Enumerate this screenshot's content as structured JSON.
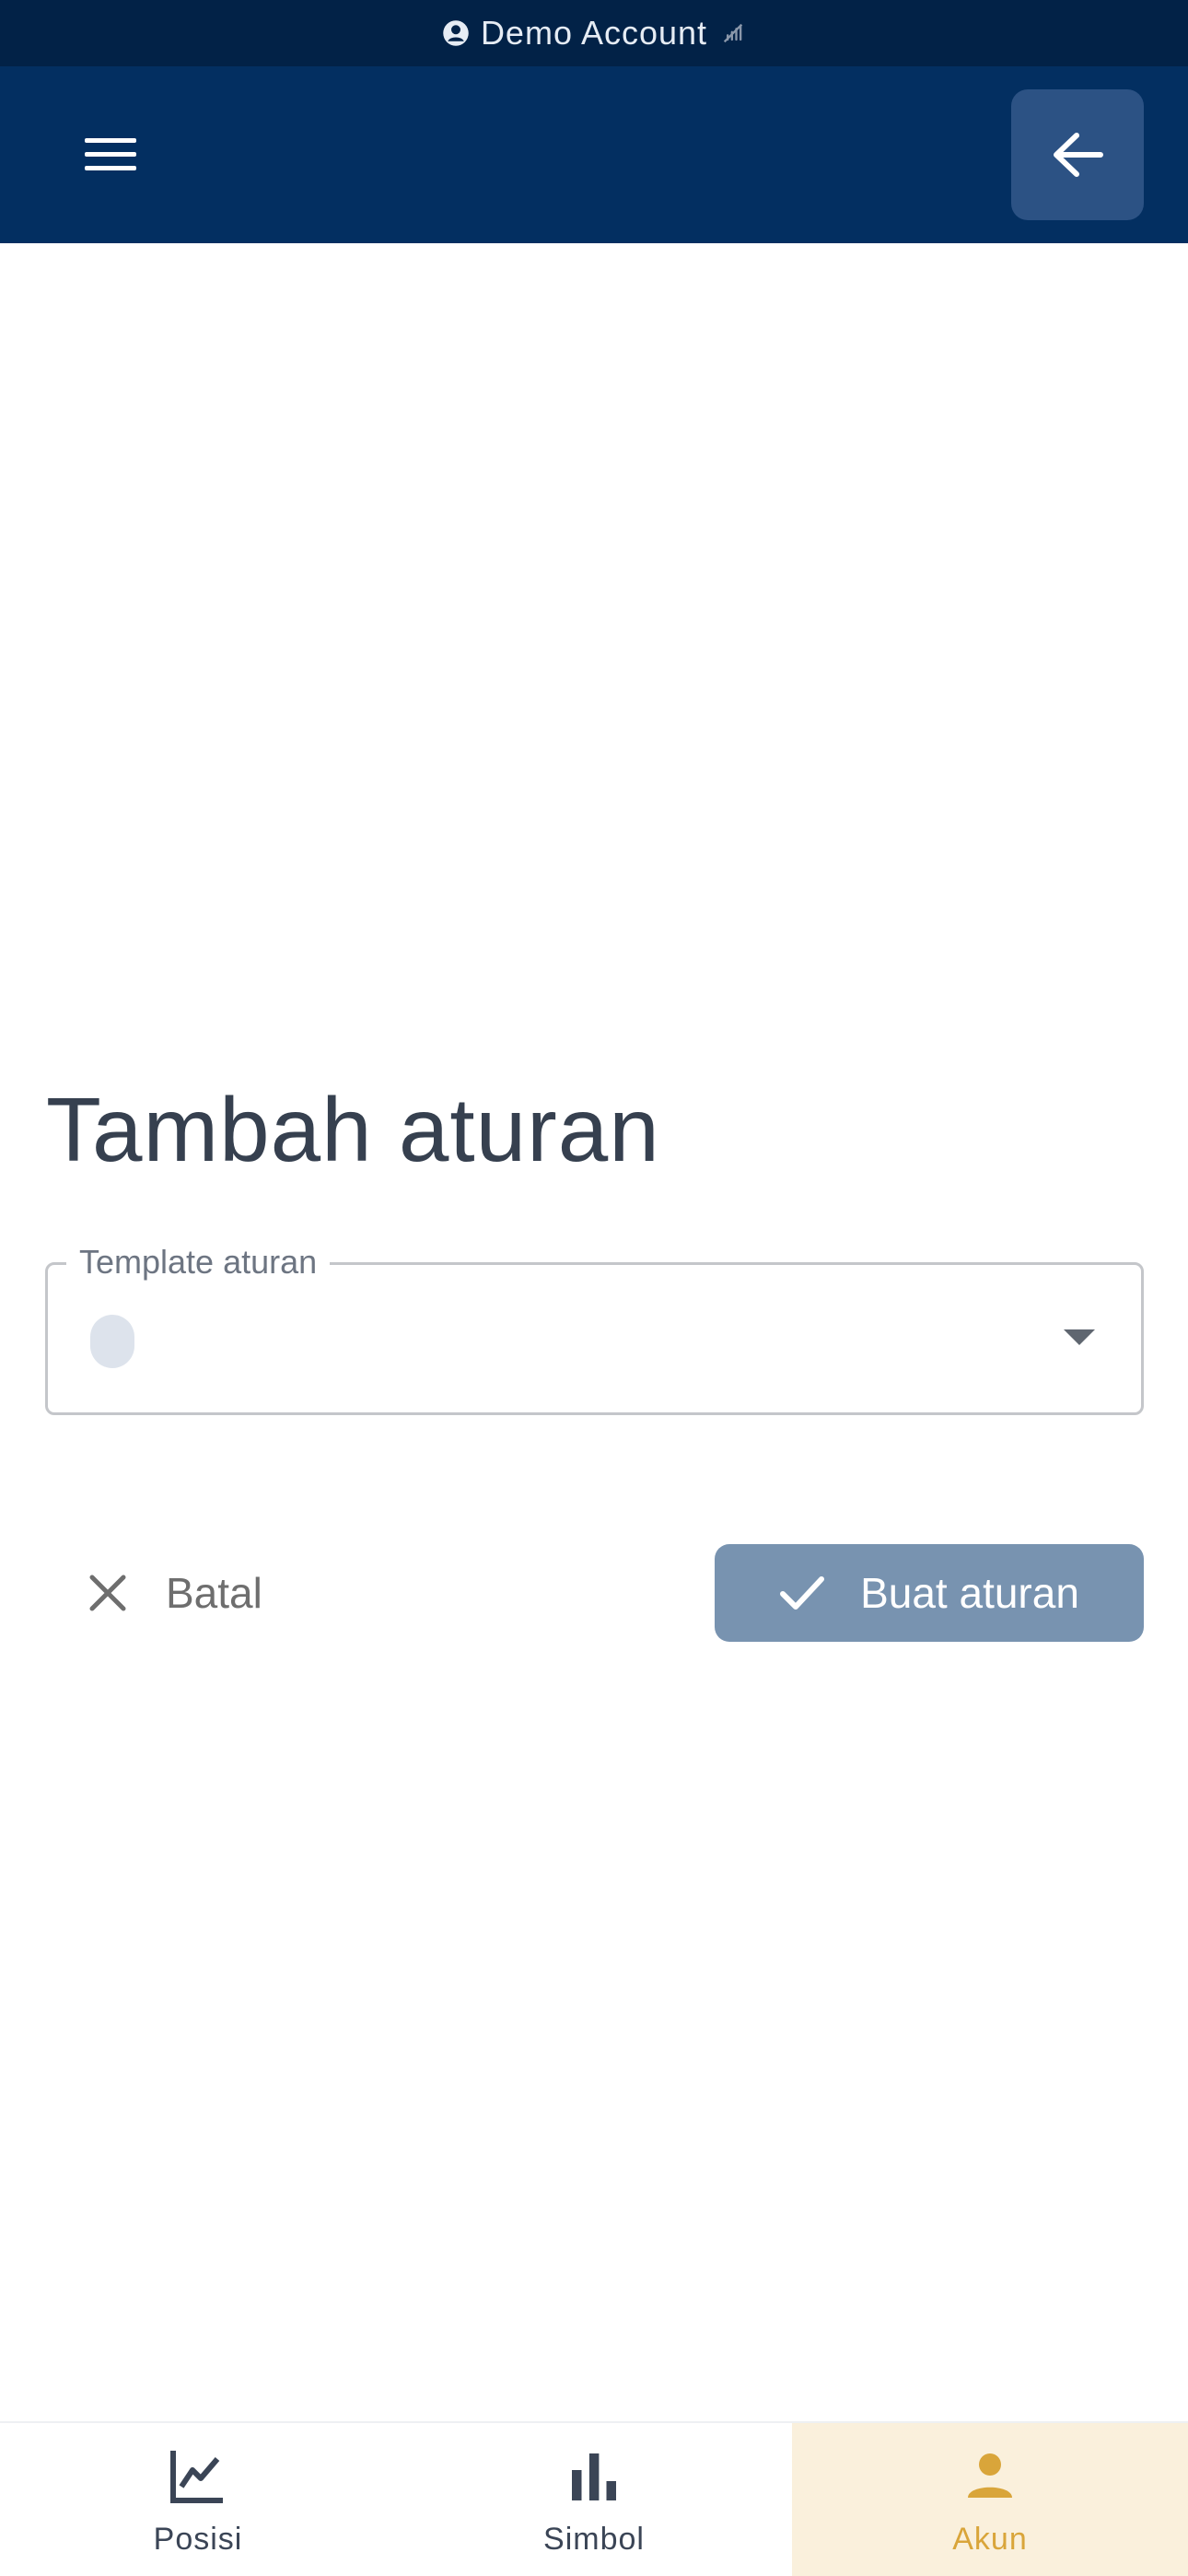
{
  "banner": {
    "text": "Demo Account",
    "icons": [
      "account-circle-icon",
      "signal-off-icon"
    ]
  },
  "appbar": {
    "menu_icon": "menu-icon",
    "back_icon": "arrow-left-icon"
  },
  "main": {
    "title": "Tambah aturan",
    "template_field": {
      "label": "Template aturan",
      "value": ""
    },
    "cancel_label": "Batal",
    "confirm_label": "Buat aturan"
  },
  "nav": {
    "items": [
      {
        "label": "Posisi",
        "icon": "line-chart-icon",
        "active": false
      },
      {
        "label": "Simbol",
        "icon": "bar-chart-icon",
        "active": false
      },
      {
        "label": "Akun",
        "icon": "person-icon",
        "active": true
      }
    ]
  },
  "colors": {
    "banner_bg": "#022247",
    "appbar_bg": "#032f61",
    "back_button_bg": "#2c5284",
    "confirm_button_bg": "#7893b0",
    "active_nav_bg": "#faf0dc",
    "active_nav_text": "#d9a53a"
  }
}
